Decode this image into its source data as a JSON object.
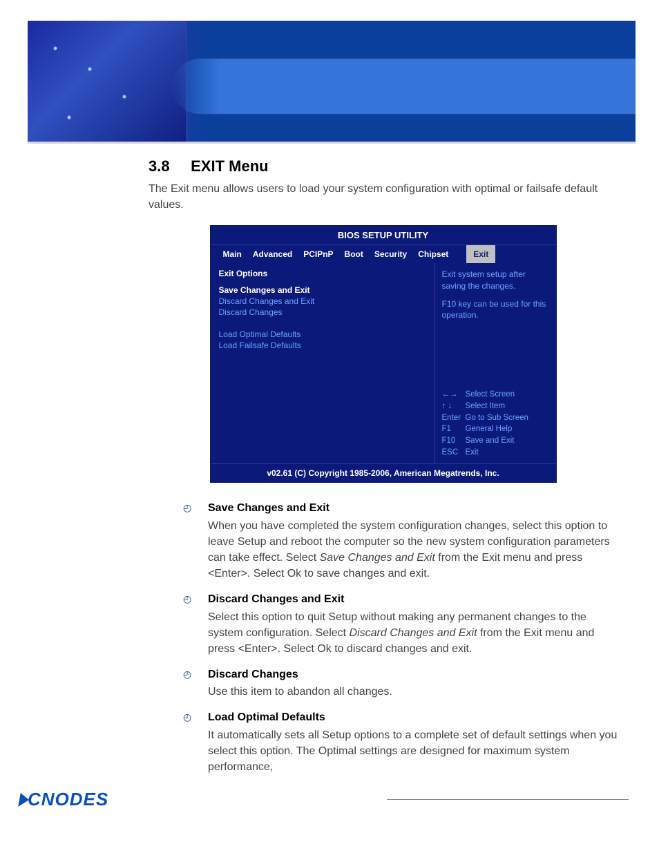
{
  "section": {
    "number": "3.8",
    "title": "EXIT Menu",
    "intro": "The Exit menu allows users to load your system configuration with optimal or failsafe default values."
  },
  "bios": {
    "title": "BIOS SETUP UTILITY",
    "tabs": [
      "Main",
      "Advanced",
      "PCIPnP",
      "Boot",
      "Security",
      "Chipset",
      "Exit"
    ],
    "active_tab": "Exit",
    "left": {
      "heading": "Exit Options",
      "items_a": [
        "Save Changes and Exit",
        "Discard Changes and Exit",
        "Discard Changes"
      ],
      "items_b": [
        "Load Optimal Defaults",
        "Load Failsafe Defaults"
      ],
      "selected": "Save Changes and Exit"
    },
    "help": {
      "line1": "Exit system setup after saving the changes.",
      "line2": "F10 key can be used for this operation."
    },
    "keys": [
      {
        "k": "←→",
        "v": "Select Screen"
      },
      {
        "k": "↑ ↓",
        "v": "Select Item"
      },
      {
        "k": "Enter",
        "v": "Go to Sub Screen"
      },
      {
        "k": "F1",
        "v": "General Help"
      },
      {
        "k": "F10",
        "v": "Save and Exit"
      },
      {
        "k": "ESC",
        "v": "Exit"
      }
    ],
    "footer": "v02.61 (C) Copyright 1985-2006, American Megatrends, Inc."
  },
  "descriptions": [
    {
      "title": "Save Changes and Exit",
      "body_pre": "When you have completed the system configuration changes, select this option to leave Setup and reboot the computer so the new system configuration parameters can take effect. Select ",
      "body_em": "Save Changes and Exit",
      "body_post": " from the Exit menu and press <Enter>. Select Ok to save changes and exit."
    },
    {
      "title": "Discard Changes and Exit",
      "body_pre": "Select this option to quit Setup without making any permanent changes to the system configuration. Select ",
      "body_em": "Discard Changes and Exit",
      "body_post": " from the Exit menu and press <Enter>. Select Ok to discard changes and exit."
    },
    {
      "title": "Discard Changes",
      "body_pre": "Use this item to abandon all changes.",
      "body_em": "",
      "body_post": ""
    },
    {
      "title": "Load Optimal Defaults",
      "body_pre": "It automatically sets all Setup options to a complete set of default settings when you select this option. The Optimal settings are designed for maximum system performance,",
      "body_em": "",
      "body_post": ""
    }
  ],
  "logo": "CNODES"
}
